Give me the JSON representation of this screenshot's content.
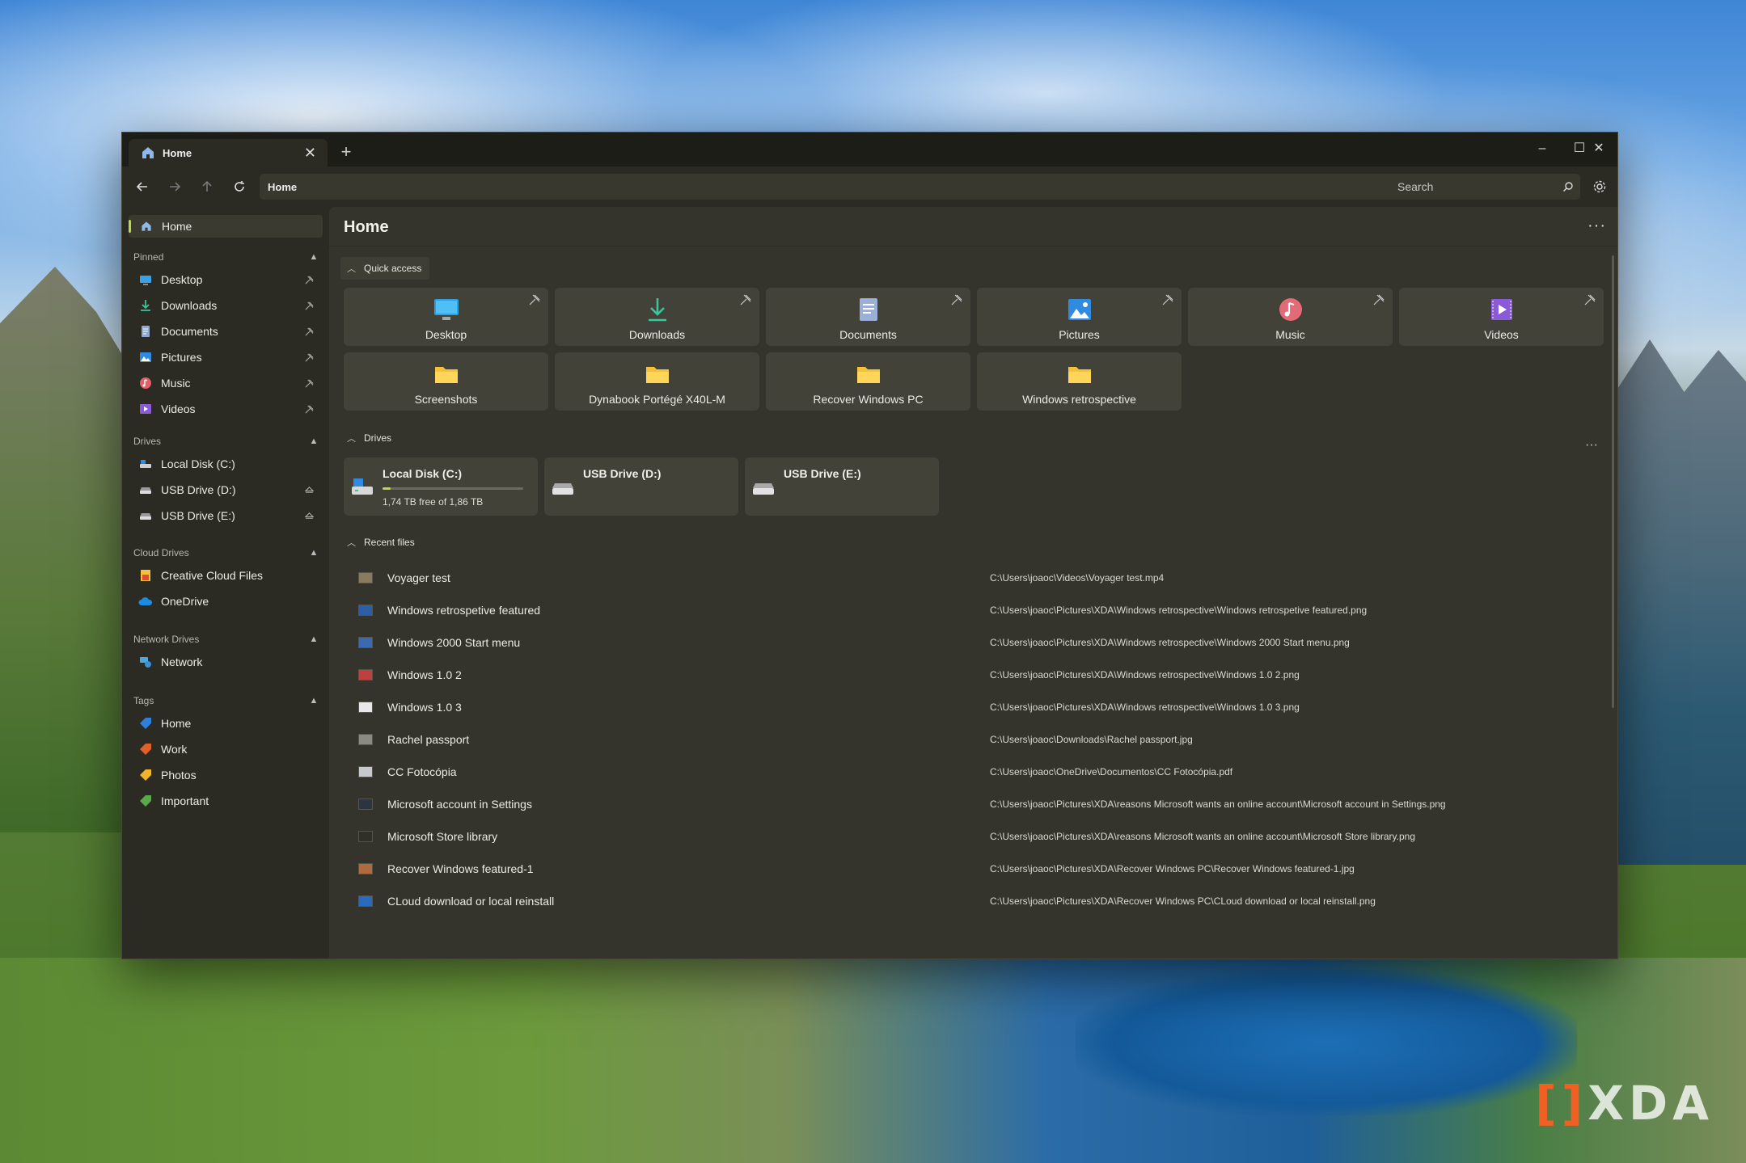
{
  "window": {
    "tab_title": "Home",
    "tab_close": "✕",
    "new_tab": "+",
    "controls": {
      "minimize": "–",
      "maximize": "☐",
      "close": "✕"
    }
  },
  "toolbar": {
    "address": "Home",
    "search_placeholder": "Search"
  },
  "sidebar": {
    "home": "Home",
    "sections": {
      "pinned": "Pinned",
      "drives": "Drives",
      "cloud": "Cloud Drives",
      "network": "Network Drives",
      "tags": "Tags"
    },
    "pinned": [
      {
        "label": "Desktop",
        "icon": "desktop-icon"
      },
      {
        "label": "Downloads",
        "icon": "download-icon"
      },
      {
        "label": "Documents",
        "icon": "document-icon"
      },
      {
        "label": "Pictures",
        "icon": "pictures-icon"
      },
      {
        "label": "Music",
        "icon": "music-icon"
      },
      {
        "label": "Videos",
        "icon": "videos-icon"
      }
    ],
    "drives": [
      {
        "label": "Local Disk (C:)"
      },
      {
        "label": "USB Drive (D:)"
      },
      {
        "label": "USB Drive (E:)"
      }
    ],
    "cloud": [
      {
        "label": "Creative Cloud Files"
      },
      {
        "label": "OneDrive"
      }
    ],
    "network": [
      {
        "label": "Network"
      }
    ],
    "tags": [
      {
        "label": "Home",
        "color": "#2f7fd8"
      },
      {
        "label": "Work",
        "color": "#e0602a"
      },
      {
        "label": "Photos",
        "color": "#f0b429"
      },
      {
        "label": "Important",
        "color": "#5aa84a"
      }
    ]
  },
  "main": {
    "title": "Home",
    "more": "···",
    "quick_access_title": "Quick access",
    "quick_access": [
      {
        "label": "Desktop",
        "icon": "desktop-icon",
        "pinned": true
      },
      {
        "label": "Downloads",
        "icon": "download-icon",
        "pinned": true
      },
      {
        "label": "Documents",
        "icon": "document-icon",
        "pinned": true
      },
      {
        "label": "Pictures",
        "icon": "pictures-icon",
        "pinned": true
      },
      {
        "label": "Music",
        "icon": "music-icon",
        "pinned": true
      },
      {
        "label": "Videos",
        "icon": "videos-icon",
        "pinned": true
      },
      {
        "label": "Screenshots",
        "icon": "folder-icon",
        "pinned": false
      },
      {
        "label": "Dynabook Portégé X40L-M",
        "icon": "folder-icon",
        "pinned": false
      },
      {
        "label": "Recover Windows PC",
        "icon": "folder-icon",
        "pinned": false
      },
      {
        "label": "Windows retrospective",
        "icon": "folder-icon",
        "pinned": false
      }
    ],
    "drives_title": "Drives",
    "drives_more": "···",
    "drives": [
      {
        "name": "Local Disk (C:)",
        "space": "1,74 TB free of 1,86 TB",
        "used_fraction": 0.06
      },
      {
        "name": "USB Drive (D:)"
      },
      {
        "name": "USB Drive (E:)"
      }
    ],
    "recent_title": "Recent files",
    "recent": [
      {
        "name": "Voyager test",
        "path": "C:\\Users\\joaoc\\Videos\\Voyager test.mp4",
        "color": "#8a7a60"
      },
      {
        "name": "Windows retrospetive featured",
        "path": "C:\\Users\\joaoc\\Pictures\\XDA\\Windows retrospective\\Windows retrospetive featured.png",
        "color": "#2d5ea8"
      },
      {
        "name": "Windows 2000 Start menu",
        "path": "C:\\Users\\joaoc\\Pictures\\XDA\\Windows retrospective\\Windows 2000 Start menu.png",
        "color": "#3a6ab0"
      },
      {
        "name": "Windows 1.0 2",
        "path": "C:\\Users\\joaoc\\Pictures\\XDA\\Windows retrospective\\Windows 1.0 2.png",
        "color": "#c04040"
      },
      {
        "name": "Windows 1.0 3",
        "path": "C:\\Users\\joaoc\\Pictures\\XDA\\Windows retrospective\\Windows 1.0 3.png",
        "color": "#e8e8e8"
      },
      {
        "name": "Rachel passport",
        "path": "C:\\Users\\joaoc\\Downloads\\Rachel passport.jpg",
        "color": "#8a8a80"
      },
      {
        "name": "CC Fotocópia",
        "path": "C:\\Users\\joaoc\\OneDrive\\Documentos\\CC Fotocópia.pdf",
        "color": "#c8c8d0"
      },
      {
        "name": "Microsoft account in Settings",
        "path": "C:\\Users\\joaoc\\Pictures\\XDA\\reasons Microsoft wants an online account\\Microsoft account in Settings.png",
        "color": "#2c3440"
      },
      {
        "name": "Microsoft Store library",
        "path": "C:\\Users\\joaoc\\Pictures\\XDA\\reasons Microsoft wants an online account\\Microsoft Store library.png",
        "color": "#30302a"
      },
      {
        "name": "Recover Windows featured-1",
        "path": "C:\\Users\\joaoc\\Pictures\\XDA\\Recover Windows PC\\Recover Windows featured-1.jpg",
        "color": "#b06a40"
      },
      {
        "name": "CLoud download  or local reinstall",
        "path": "C:\\Users\\joaoc\\Pictures\\XDA\\Recover Windows PC\\CLoud download  or local reinstall.png",
        "color": "#2a6ac0"
      }
    ]
  },
  "watermark": {
    "bracket": "[]",
    "text": "XDA"
  },
  "colors": {
    "accent": "#b9d84a",
    "folder": "#f5c13a"
  }
}
